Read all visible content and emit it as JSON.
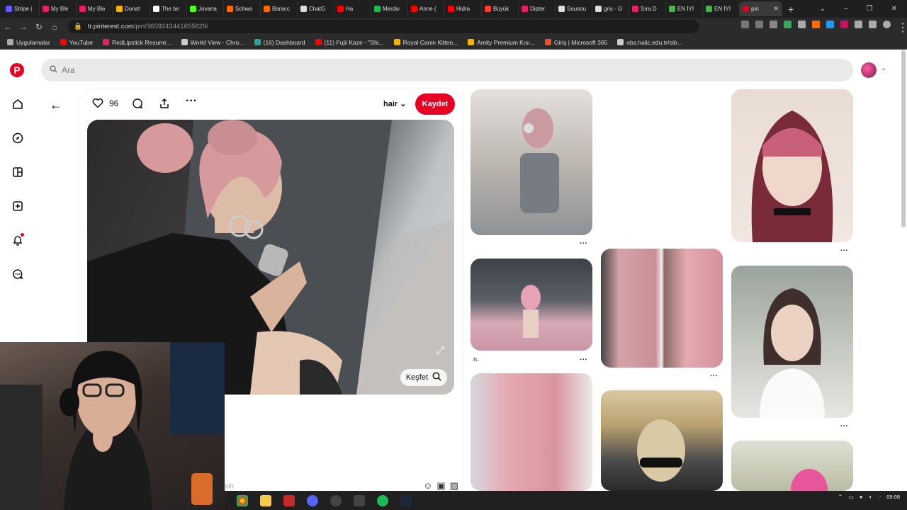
{
  "tabs": [
    {
      "title": "Stripe |",
      "color": "#635bff"
    },
    {
      "title": "My Ble",
      "color": "#e91e63"
    },
    {
      "title": "My Ble",
      "color": "#e91e63"
    },
    {
      "title": "Donat",
      "color": "#f4b400"
    },
    {
      "title": "The be",
      "color": "#ffffff"
    },
    {
      "title": "Jovana",
      "color": "#53fc18"
    },
    {
      "title": "Schwa",
      "color": "#ff6a00"
    },
    {
      "title": "Baracc",
      "color": "#ff6a00"
    },
    {
      "title": "ChatG",
      "color": "#dddddd"
    },
    {
      "title": "Ha",
      "color": "#ff0000"
    },
    {
      "title": "Merdiv",
      "color": "#1db954"
    },
    {
      "title": "Anne (",
      "color": "#ff0000"
    },
    {
      "title": "Hidra",
      "color": "#ff0000"
    },
    {
      "title": "Büyük",
      "color": "#ff3b30"
    },
    {
      "title": "Dipter",
      "color": "#e91e63"
    },
    {
      "title": "Sousou",
      "color": "#dddddd"
    },
    {
      "title": "gris - G",
      "color": "#dddddd"
    },
    {
      "title": "Sıra D",
      "color": "#e91e63"
    },
    {
      "title": "EN İYİ",
      "color": "#4caf50"
    },
    {
      "title": "EN İYİ",
      "color": "#4caf50"
    }
  ],
  "active_tab": {
    "title": "pin",
    "color": "#e60023"
  },
  "new_tab_label": "+",
  "window_controls": [
    "⌄",
    "–",
    "❐",
    "✕"
  ],
  "nav": {
    "back": "←",
    "forward": "→",
    "reload": "↻",
    "home": "⌂"
  },
  "url": {
    "host": "tr.pinterest.com",
    "path": "/pin/3659243441655629/"
  },
  "bookmarks": [
    {
      "label": "Uygulamalar",
      "color": "#aaaaaa"
    },
    {
      "label": "YouTube",
      "color": "#ff0000"
    },
    {
      "label": "RedLipstick Resurre...",
      "color": "#e91e63"
    },
    {
      "label": "World View - Chro...",
      "color": "#cccccc"
    },
    {
      "label": "(16) Dashboard",
      "color": "#26a69a"
    },
    {
      "label": "(11) Fujii Kaze - \"Shi...",
      "color": "#ff0000"
    },
    {
      "label": "Royal Canin Kitten...",
      "color": "#f4b400"
    },
    {
      "label": "Amity Premium Kısı...",
      "color": "#f4b400"
    },
    {
      "label": "Giriş | Microsoft 365",
      "color": "#f25022"
    },
    {
      "label": "obs.halic.edu.tr/oib...",
      "color": "#cccccc"
    }
  ],
  "pinterest": {
    "logo": "P",
    "search_placeholder": "Ara",
    "rail_icons": [
      "home-icon",
      "compass-icon",
      "dashboard-icon",
      "create-icon",
      "notifications-icon",
      "messages-icon"
    ],
    "pin": {
      "likes": "96",
      "board": "hair",
      "save_label": "Kaydet",
      "explore_label": "Keşfet",
      "comment_placeholder": "yin"
    },
    "captions": {
      "car_pin": "n."
    },
    "more_dots": "···"
  },
  "colors": {
    "brand": "#e60023",
    "notification_dot": "#e60023"
  },
  "taskbar": {
    "time": "09:08",
    "date": ""
  }
}
